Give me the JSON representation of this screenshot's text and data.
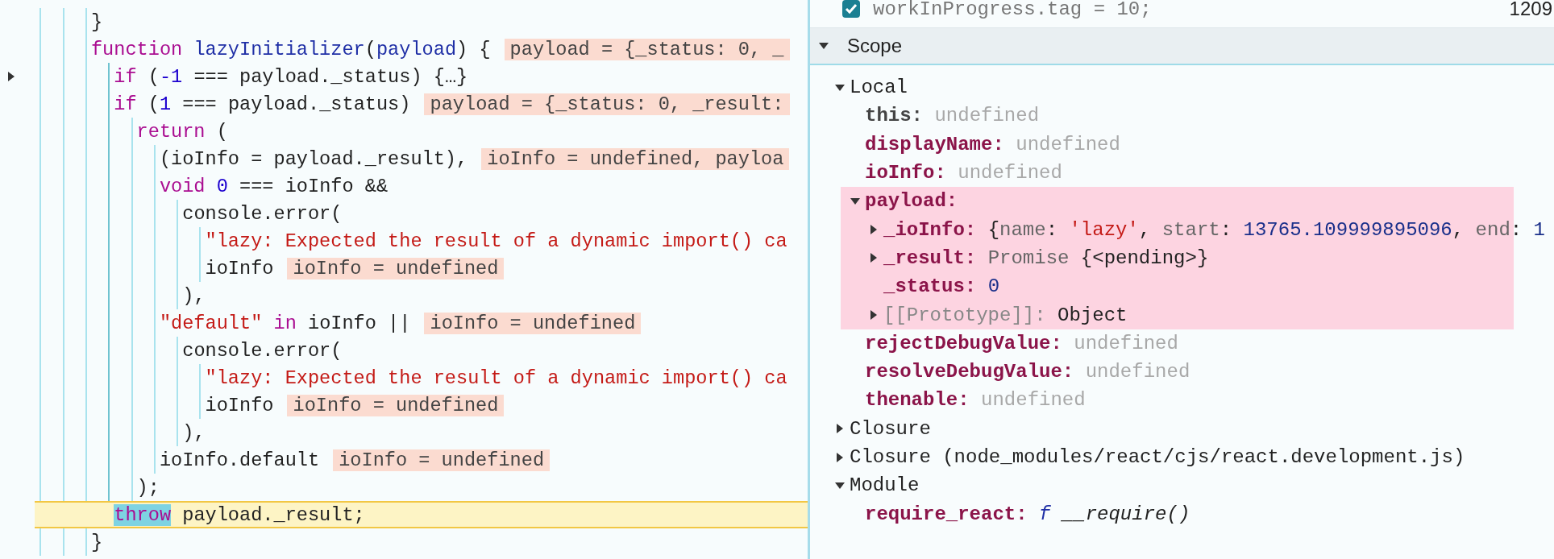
{
  "editor": {
    "lines": [
      {
        "folded": false,
        "paused": false,
        "tokens": [
          {
            "t": "}",
            "kind": "plain"
          }
        ]
      },
      {
        "folded": false,
        "paused": false,
        "tokens": [
          {
            "t": "function",
            "kind": "kw"
          },
          {
            "t": " lazyInitializer",
            "kind": "def"
          },
          {
            "t": "(",
            "kind": "plain"
          },
          {
            "t": "payload",
            "kind": "def"
          },
          {
            "t": ") {",
            "kind": "plain"
          }
        ],
        "inline_value": "payload = {_status: 0, _",
        "children": [
          {
            "folded": true,
            "paused": false,
            "tokens": [
              {
                "t": "if",
                "kind": "kw"
              },
              {
                "t": " (",
                "kind": "plain"
              },
              {
                "t": "-1",
                "kind": "num"
              },
              {
                "t": " === payload._status) {…}",
                "kind": "plain"
              }
            ]
          },
          {
            "folded": false,
            "paused": false,
            "tokens": [
              {
                "t": "if",
                "kind": "kw"
              },
              {
                "t": " (",
                "kind": "plain"
              },
              {
                "t": "1",
                "kind": "num"
              },
              {
                "t": " === payload._status)",
                "kind": "plain"
              }
            ],
            "inline_value": "payload = {_status: 0, _result:",
            "children": [
              {
                "folded": false,
                "paused": false,
                "tokens": [
                  {
                    "t": "return",
                    "kind": "kw"
                  },
                  {
                    "t": " (",
                    "kind": "plain"
                  }
                ],
                "children": [
                  {
                    "folded": false,
                    "paused": false,
                    "tokens": [
                      {
                        "t": "(ioInfo = payload._result),",
                        "kind": "plain"
                      }
                    ],
                    "inline_value": "ioInfo = undefined, payloa"
                  },
                  {
                    "folded": false,
                    "paused": false,
                    "tokens": [
                      {
                        "t": "void",
                        "kind": "kw"
                      },
                      {
                        "t": " 0",
                        "kind": "num"
                      },
                      {
                        "t": " === ioInfo &&",
                        "kind": "plain"
                      }
                    ],
                    "children": [
                      {
                        "folded": false,
                        "paused": false,
                        "tokens": [
                          {
                            "t": "console.error(",
                            "kind": "plain"
                          }
                        ],
                        "children": [
                          {
                            "folded": false,
                            "paused": false,
                            "tokens": [
                              {
                                "t": "\"lazy: Expected the result of a dynamic import() ca",
                                "kind": "str"
                              }
                            ]
                          },
                          {
                            "folded": false,
                            "paused": false,
                            "tokens": [
                              {
                                "t": "ioInfo",
                                "kind": "plain"
                              }
                            ],
                            "inline_value": "ioInfo = undefined"
                          }
                        ]
                      },
                      {
                        "folded": false,
                        "paused": false,
                        "tokens": [
                          {
                            "t": "),",
                            "kind": "plain"
                          }
                        ]
                      }
                    ]
                  },
                  {
                    "folded": false,
                    "paused": false,
                    "tokens": [
                      {
                        "t": "\"default\"",
                        "kind": "str"
                      },
                      {
                        "t": " in",
                        "kind": "kw"
                      },
                      {
                        "t": " ioInfo ||",
                        "kind": "plain"
                      }
                    ],
                    "inline_value": "ioInfo = undefined",
                    "children": [
                      {
                        "folded": false,
                        "paused": false,
                        "tokens": [
                          {
                            "t": "console.error(",
                            "kind": "plain"
                          }
                        ],
                        "children": [
                          {
                            "folded": false,
                            "paused": false,
                            "tokens": [
                              {
                                "t": "\"lazy: Expected the result of a dynamic import() ca",
                                "kind": "str"
                              }
                            ]
                          },
                          {
                            "folded": false,
                            "paused": false,
                            "tokens": [
                              {
                                "t": "ioInfo",
                                "kind": "plain"
                              }
                            ],
                            "inline_value": "ioInfo = undefined"
                          }
                        ]
                      },
                      {
                        "folded": false,
                        "paused": false,
                        "tokens": [
                          {
                            "t": "),",
                            "kind": "plain"
                          }
                        ]
                      }
                    ]
                  },
                  {
                    "folded": false,
                    "paused": false,
                    "tokens": [
                      {
                        "t": "ioInfo.default",
                        "kind": "plain"
                      }
                    ],
                    "inline_value": "ioInfo = undefined"
                  }
                ]
              },
              {
                "folded": false,
                "paused": false,
                "tokens": [
                  {
                    "t": ");",
                    "kind": "plain"
                  }
                ]
              }
            ]
          },
          {
            "folded": false,
            "paused": true,
            "tokens": [
              {
                "t": "throw",
                "kind": "hit"
              },
              {
                "t": " payload._result;",
                "kind": "plain"
              }
            ]
          }
        ]
      },
      {
        "folded": false,
        "paused": false,
        "tokens": [
          {
            "t": "}",
            "kind": "plain"
          }
        ]
      }
    ]
  },
  "debugger": {
    "watch_row": {
      "checked": true,
      "expression": "workInProgress.tag = 10;",
      "line": "1209"
    },
    "scope": {
      "title": "Scope",
      "expanded": true,
      "sections": [
        {
          "label": "Local",
          "expanded": true,
          "children": [
            {
              "name": "this:",
              "kind": "special",
              "highlighted": false,
              "value": [
                {
                  "t": "undefined",
                  "kind": "undef"
                }
              ]
            },
            {
              "name": "displayName:",
              "kind": "own",
              "highlighted": false,
              "value": [
                {
                  "t": "undefined",
                  "kind": "undef"
                }
              ]
            },
            {
              "name": "ioInfo:",
              "kind": "own",
              "highlighted": false,
              "value": [
                {
                  "t": "undefined",
                  "kind": "undef"
                }
              ]
            },
            {
              "name": "payload:",
              "kind": "own",
              "highlighted": true,
              "expanded": true,
              "children": [
                {
                  "name": "_ioInfo:",
                  "kind": "own",
                  "expanded": false,
                  "value": [
                    {
                      "t": "{",
                      "kind": "punct"
                    },
                    {
                      "t": "name",
                      "kind": "key"
                    },
                    {
                      "t": ": ",
                      "kind": "punct"
                    },
                    {
                      "t": "'lazy'",
                      "kind": "str"
                    },
                    {
                      "t": ", ",
                      "kind": "punct"
                    },
                    {
                      "t": "start",
                      "kind": "key"
                    },
                    {
                      "t": ": ",
                      "kind": "punct"
                    },
                    {
                      "t": "13765.109999895096",
                      "kind": "num"
                    },
                    {
                      "t": ", ",
                      "kind": "punct"
                    },
                    {
                      "t": "end",
                      "kind": "key"
                    },
                    {
                      "t": ": ",
                      "kind": "punct"
                    },
                    {
                      "t": "1",
                      "kind": "num"
                    }
                  ]
                },
                {
                  "name": "_result:",
                  "kind": "own",
                  "expanded": false,
                  "value": [
                    {
                      "t": "Promise",
                      "kind": "preview"
                    },
                    {
                      "t": " {<pending>}",
                      "kind": "punct"
                    }
                  ]
                },
                {
                  "name": "_status:",
                  "kind": "own",
                  "value": [
                    {
                      "t": "0",
                      "kind": "num"
                    }
                  ]
                },
                {
                  "name": "[[Prototype]]:",
                  "kind": "internal",
                  "expanded": false,
                  "value": [
                    {
                      "t": "Object",
                      "kind": "punct"
                    }
                  ]
                }
              ]
            },
            {
              "name": "rejectDebugValue:",
              "kind": "own",
              "highlighted": false,
              "value": [
                {
                  "t": "undefined",
                  "kind": "undef"
                }
              ]
            },
            {
              "name": "resolveDebugValue:",
              "kind": "own",
              "highlighted": false,
              "value": [
                {
                  "t": "undefined",
                  "kind": "undef"
                }
              ]
            },
            {
              "name": "thenable:",
              "kind": "own",
              "highlighted": false,
              "value": [
                {
                  "t": "undefined",
                  "kind": "undef"
                }
              ]
            }
          ]
        },
        {
          "label": "Closure",
          "expanded": false
        },
        {
          "label": "Closure (node_modules/react/cjs/react.development.js)",
          "expanded": false
        },
        {
          "label": "Module",
          "expanded": true,
          "children": [
            {
              "name": "require_react:",
              "kind": "own",
              "value": [
                {
                  "t": "f",
                  "kind": "fn"
                },
                {
                  "t": " __require()",
                  "kind": "fnbody"
                }
              ]
            }
          ]
        }
      ]
    }
  }
}
